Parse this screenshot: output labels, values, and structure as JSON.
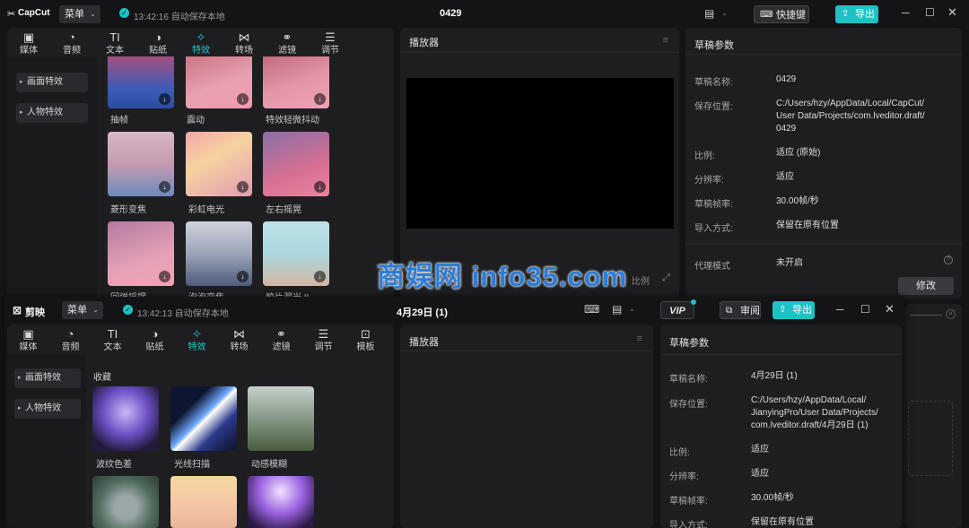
{
  "back": {
    "app_name": "CapCut",
    "menu_label": "菜单",
    "autosave": "13:42:16 自动保存本地",
    "project_title": "0429",
    "shortcut_label": "快捷键",
    "export_label": "导出",
    "tabs": [
      "媒体",
      "音频",
      "文本",
      "贴纸",
      "特效",
      "转场",
      "滤镜",
      "调节"
    ],
    "sidebar": [
      "画面特效",
      "人物特效"
    ],
    "thumbs": [
      "抽帧",
      "震动",
      "特效轻微抖动",
      "菱形变焦",
      "彩虹电光",
      "左右摇晃",
      "回弹摇摆",
      "泡泡变焦",
      "胶片漏光 II"
    ],
    "player_title": "播放器",
    "player_ratio": "比例",
    "draft_title": "草稿参数",
    "props": [
      {
        "k": "草稿名称:",
        "v": "0429"
      },
      {
        "k": "保存位置:",
        "v": "C:/Users/hzy/AppData/Local/CapCut/\nUser Data/Projects/com.lveditor.draft/\n0429"
      },
      {
        "k": "比例:",
        "v": "适应 (原始)"
      },
      {
        "k": "分辨率:",
        "v": "适应"
      },
      {
        "k": "草稿帧率:",
        "v": "30.00帧/秒"
      },
      {
        "k": "导入方式:",
        "v": "保留在原有位置"
      },
      {
        "k": "代理模式",
        "v": "未开启"
      }
    ],
    "modify_label": "修改"
  },
  "front": {
    "app_name": "剪映",
    "menu_label": "菜单",
    "autosave": "13:42:13 自动保存本地",
    "project_title": "4月29日 (1)",
    "vip_label": "VIP",
    "review_label": "审阅",
    "export_label": "导出",
    "tabs": [
      "媒体",
      "音频",
      "文本",
      "贴纸",
      "特效",
      "转场",
      "滤镜",
      "调节",
      "模板"
    ],
    "sidebar": [
      "画面特效",
      "人物特效"
    ],
    "section_title": "收藏",
    "thumbs": [
      "波纹色差",
      "光线扫描",
      "动感模糊"
    ],
    "player_title": "播放器",
    "draft_title": "草稿参数",
    "props": [
      {
        "k": "草稿名称:",
        "v": "4月29日 (1)"
      },
      {
        "k": "保存位置:",
        "v": "C:/Users/hzy/AppData/Local/\nJianyingPro/User Data/Projects/\ncom.lveditor.draft/4月29日 (1)"
      },
      {
        "k": "比例:",
        "v": "适应"
      },
      {
        "k": "分辨率:",
        "v": "适应"
      },
      {
        "k": "草稿帧率:",
        "v": "30.00帧/秒"
      },
      {
        "k": "导入方式:",
        "v": "保留在原有位置"
      }
    ]
  },
  "watermark": "商娱网 info35.com",
  "colors": {
    "accent": "#1ec2c5",
    "watermark": "#2e7dd6",
    "panel": "#1e1e21",
    "bg": "#141416"
  }
}
